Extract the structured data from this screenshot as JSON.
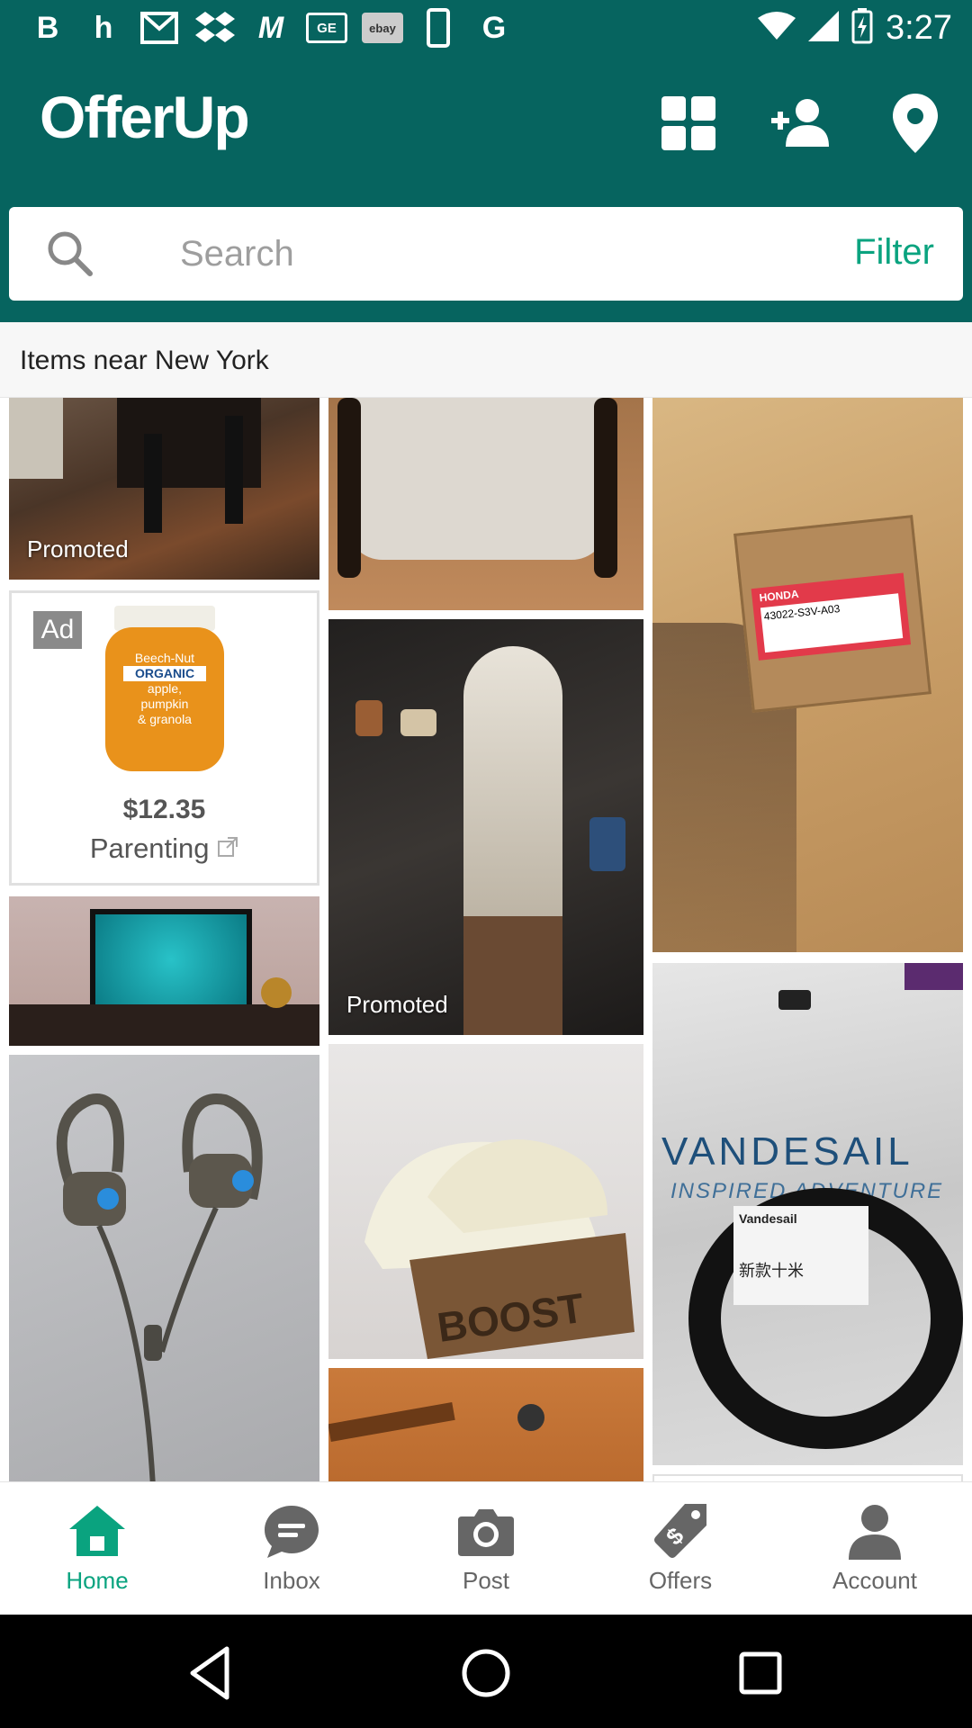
{
  "status_bar": {
    "time": "3:27",
    "left_icons": [
      "b-app-icon",
      "h-app-icon",
      "mail-icon",
      "dropbox-icon",
      "m-app-icon",
      "ge-icon",
      "ebay-icon",
      "phone-icon",
      "google-icon"
    ],
    "ebay_label": "ebay",
    "ge_label": "GE",
    "b_glyph": "B",
    "h_glyph": "h",
    "g_glyph": "G",
    "m_glyph": "M"
  },
  "header": {
    "logo": "OfferUp",
    "icons": [
      "grid-icon",
      "add-person-icon",
      "location-pin-icon"
    ]
  },
  "search": {
    "placeholder": "Search",
    "filter_label": "Filter"
  },
  "location_bar": {
    "label": "Items near New York"
  },
  "feed": {
    "promoted_label": "Promoted",
    "ad": {
      "badge": "Ad",
      "price": "$12.35",
      "category": "Parenting",
      "product_lines": [
        "Beech-Nut",
        "ORGANIC",
        "apple, pumpkin",
        "& granola"
      ]
    },
    "vandesail": {
      "brand": "VANDESAIL",
      "tagline": "INSPIRED ADVENTURE",
      "sticker": "Vandesail",
      "sticker_cn": "新款十米"
    },
    "honda_label": "HONDA",
    "honda_part": "43022-S3V-A03",
    "boost_text": "BOOST"
  },
  "bottom_nav": {
    "items": [
      {
        "label": "Home",
        "icon": "home-icon",
        "active": true
      },
      {
        "label": "Inbox",
        "icon": "chat-icon",
        "active": false
      },
      {
        "label": "Post",
        "icon": "camera-icon",
        "active": false
      },
      {
        "label": "Offers",
        "icon": "price-tag-icon",
        "active": false
      },
      {
        "label": "Account",
        "icon": "person-icon",
        "active": false
      }
    ]
  },
  "colors": {
    "brand_teal": "#06645f",
    "accent_green": "#0aa37f"
  }
}
